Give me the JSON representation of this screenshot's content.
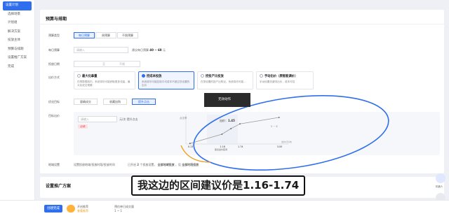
{
  "sidebar": {
    "items": [
      {
        "label": "设置计划",
        "active": true
      },
      {
        "label": "选择场景"
      },
      {
        "label": "计划组"
      },
      {
        "label": "解决方案"
      },
      {
        "label": "投放主体"
      },
      {
        "label": "预算与排期"
      },
      {
        "label": "设置推广方案"
      },
      {
        "label": "完成"
      }
    ]
  },
  "budget_section": {
    "title": "预算与排期",
    "budget_type": {
      "label": "预算类型",
      "options": [
        "每日预算",
        "周预算",
        "不限预算"
      ],
      "selected": 0
    },
    "daily_budget": {
      "label": "每日预算",
      "placeholder": "请输入",
      "hint_prefix": "建议每日预算",
      "hint_value": "40 ~ 60",
      "hint_unit": "元"
    },
    "schedule": {
      "label": "投放日期",
      "start": "",
      "sep": "至",
      "end": "不限"
    },
    "bid_method": {
      "label": "出价方式",
      "options": [
        {
          "title": "最大化拿量",
          "desc": "在预算限制内，系统将尽可能获取更多流量，最大化成交规模"
        },
        {
          "title": "控成本投放",
          "desc": "系统将尽可能控制平均成本不超过您设置的出价"
        },
        {
          "title": "控投产比投放",
          "desc": "在您设置的投产比附近，系统将尽可能..."
        },
        {
          "title": "手动出价（原智能调价）",
          "desc": "手动设置关键词出价，成本可控"
        }
      ],
      "selected": 1
    },
    "bid_target": {
      "label": "优化目标",
      "options": [
        "量确成交",
        "收藏加购",
        "提升点击"
      ],
      "selected": 2
    },
    "bid_value": {
      "label": "目标出价",
      "placeholder": "请输入",
      "unit": "元/次 提升点击",
      "tag": "必填"
    },
    "chart_data": {
      "type": "line",
      "ylabel": "点击率",
      "xlabel": "出价(元/次)",
      "x": [
        0.13,
        1.16,
        1.45,
        1.74,
        3.0
      ],
      "series": [
        {
          "values": [
            0.02,
            0.35,
            0.55,
            0.72,
            0.95
          ]
        }
      ],
      "annotations": {
        "current_label": "出价：",
        "current_value": "1.45",
        "range_note": "5 ~ 8",
        "range_label": "建议出价区间"
      },
      "x_ticks": [
        "0.13",
        "1.16",
        "1.74",
        "3.00"
      ]
    },
    "tooltip": "无效动作",
    "region": {
      "label": "地域设置",
      "value": "设置投放地域/投放时段/投放时间",
      "note_prefix": "已开启",
      "note_count": "2",
      "note_mid": "个投放设置，",
      "link1": "全部地域投放",
      "note_mid2": "，设",
      "link2": "全部时段投放"
    }
  },
  "plan_section": {
    "title": "设置推广方案"
  },
  "subtitle": "我这边的区间建议价是1.16-1.74",
  "bottom_bar": {
    "create_button": "创建完成",
    "toggle_label": "开启推荐",
    "toggle_sub": "查看推荐",
    "summary_label": "预估单日成交量",
    "summary_value": "1 ~ 1"
  },
  "right_bar": {
    "robot_label": "机器人",
    "help_label": "反馈"
  },
  "colors": {
    "accent": "#2f6fed",
    "curve": "#999999",
    "highlight_ring": "#2f6fed",
    "highlight_arc": "#f0a020"
  }
}
